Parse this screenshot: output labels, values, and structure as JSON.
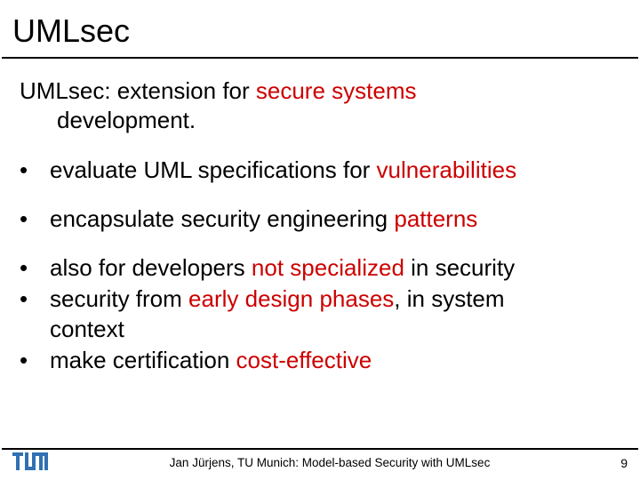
{
  "title": "UMLsec",
  "intro": {
    "prefix": "UMLsec: extension for ",
    "highlight": "secure systems",
    "line2": "development."
  },
  "bullets": [
    {
      "pre": "evaluate UML specifications for ",
      "red": "vulnerabilities",
      "post": ""
    },
    {
      "pre": "encapsulate security engineering ",
      "red": "patterns",
      "post": ""
    },
    {
      "pre": "also for developers ",
      "red": "not specialized",
      "post": " in security"
    },
    {
      "pre": "security from ",
      "red": "early design phases",
      "post": ", in system",
      "cont": "context"
    },
    {
      "pre": "make certification ",
      "red": "cost-effective",
      "post": ""
    }
  ],
  "footer": {
    "text": "Jan Jürjens, TU Munich: Model-based Security with UMLsec",
    "page": "9"
  }
}
